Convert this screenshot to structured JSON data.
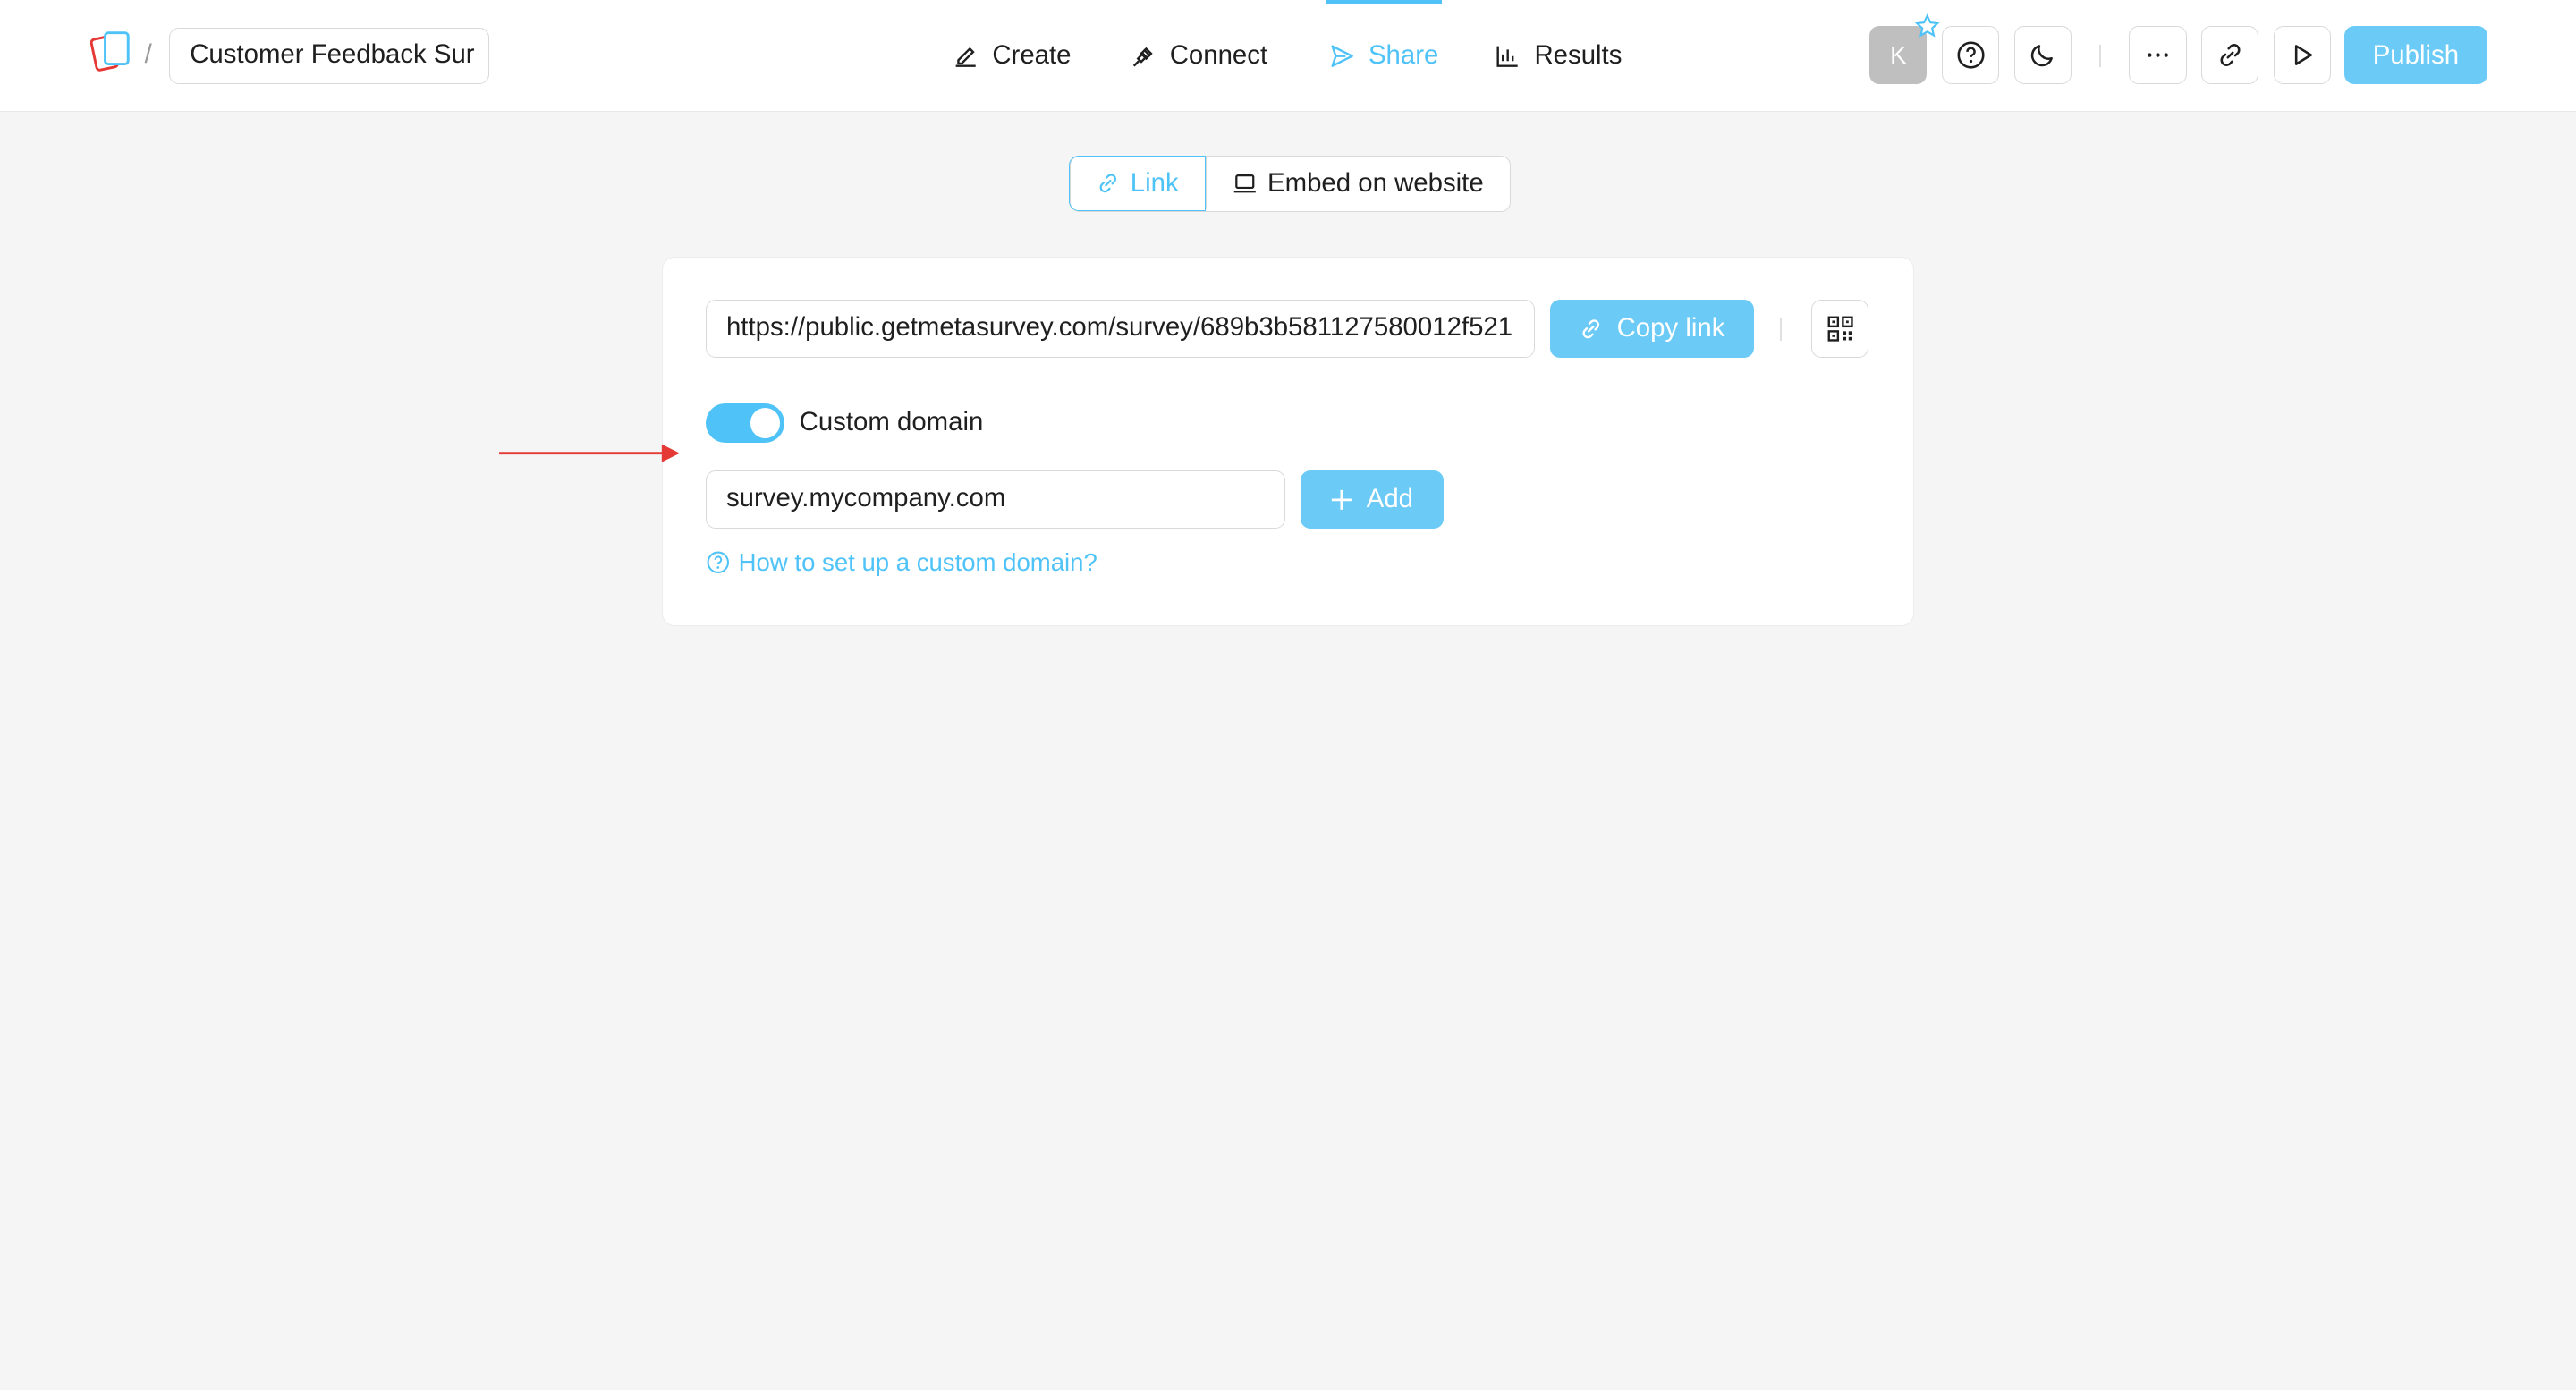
{
  "header": {
    "breadcrumb_separator": "/",
    "survey_title": "Customer Feedback Sur",
    "nav": [
      {
        "label": "Create",
        "icon": "pencil-icon"
      },
      {
        "label": "Connect",
        "icon": "plug-icon"
      },
      {
        "label": "Share",
        "icon": "send-icon",
        "active": true
      },
      {
        "label": "Results",
        "icon": "bar-chart-icon"
      }
    ],
    "avatar_initial": "K",
    "publish_label": "Publish"
  },
  "share": {
    "tabs": [
      {
        "label": "Link",
        "icon": "link-icon",
        "active": true
      },
      {
        "label": "Embed on website",
        "icon": "laptop-icon"
      }
    ],
    "survey_url": "https://public.getmetasurvey.com/survey/689b3b581127580012f521",
    "copy_label": "Copy link",
    "custom_domain_label": "Custom domain",
    "custom_domain_enabled": true,
    "custom_domain_value": "survey.mycompany.com",
    "add_label": "Add",
    "help_link": "How to set up a custom domain?"
  },
  "colors": {
    "accent": "#4fc3f7",
    "button": "#6ccbf6",
    "annotation_arrow": "#e53935"
  }
}
